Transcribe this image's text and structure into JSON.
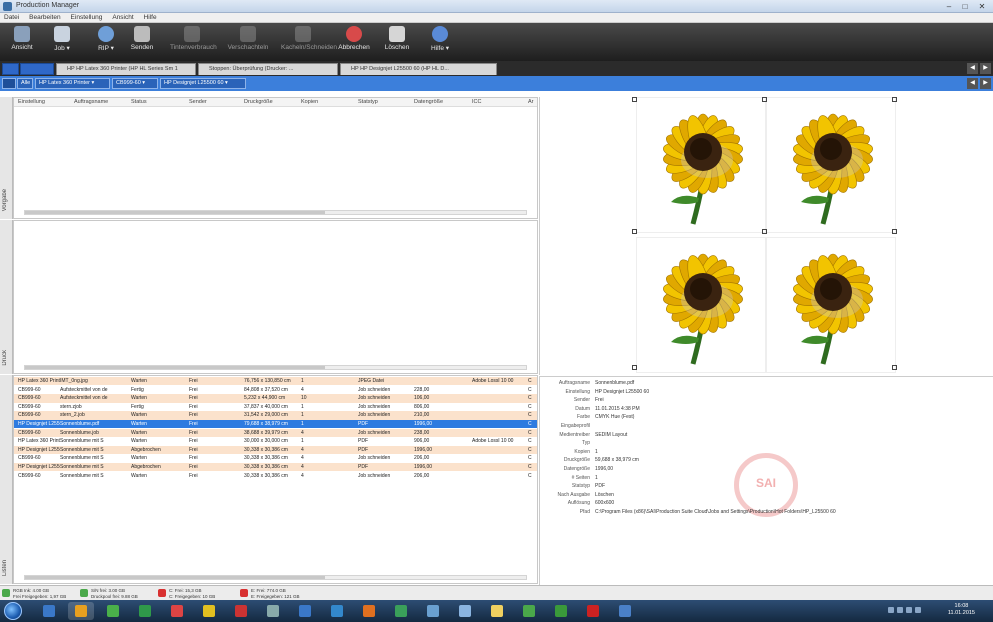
{
  "window": {
    "title": "Production Manager"
  },
  "menu": [
    "Datei",
    "Bearbeiten",
    "Einstellung",
    "Ansicht",
    "Hilfe"
  ],
  "toolbar": [
    {
      "label": "Ansicht",
      "icon": "view-icon",
      "enabled": true
    },
    {
      "label": "Job ▾",
      "icon": "folder-icon",
      "enabled": true
    },
    {
      "label": "RIP ▾",
      "icon": "rip-icon",
      "enabled": true
    },
    {
      "label": "Senden",
      "icon": "send-icon",
      "enabled": true
    },
    {
      "label": "Tintenverbrauch",
      "icon": "ink-icon",
      "enabled": false
    },
    {
      "label": "Verschachteln",
      "icon": "nest-icon",
      "enabled": false
    },
    {
      "label": "Kacheln/Schneiden",
      "icon": "tile-icon",
      "enabled": false
    },
    {
      "label": "Abbrechen",
      "icon": "cancel-icon",
      "enabled": true
    },
    {
      "label": "Löschen",
      "icon": "delete-icon",
      "enabled": true
    },
    {
      "label": "Hilfe ▾",
      "icon": "help-icon",
      "enabled": true
    }
  ],
  "tabs": [
    "HP HP Latex 360 Printer (HP HL Series Sm 1",
    "Stoppen: Überprüfung (Drucker: ...",
    "HP HP Designjet L25500 60 (HP HL D..."
  ],
  "filters": [
    "Alle",
    "HP Latex 360 Printer ▾",
    "CB999-60 ▾",
    "HP Designjet L25500 60 ▾"
  ],
  "side_labels": {
    "top": "Vorgabe",
    "mid": "Druck",
    "bottom": "Listen"
  },
  "columns": [
    "Einstellung",
    "Auftragsname",
    "Status",
    "Sender",
    "Druckgröße",
    "Kopien",
    "Statstyp",
    "Datengröße",
    "ICC",
    "Ar"
  ],
  "jobs": [
    {
      "c": [
        "HP Latex 360 Printer",
        "IMT_0ng.jpg",
        "Warten",
        "Frei",
        "76,756 x 130,850 cm",
        "1",
        "JPEG Datei",
        "",
        "Adobe Lossl 10 00",
        "C"
      ],
      "style": "peach"
    },
    {
      "c": [
        "CB999-60",
        "Aufsteckmittel von de",
        "Fertig",
        "Frei",
        "84,808 x 37,520 cm",
        "4",
        "Job schneiden",
        "228,00",
        "",
        "C"
      ],
      "style": "white"
    },
    {
      "c": [
        "CB999-60",
        "Aufsteckmittel von de",
        "Warten",
        "Frei",
        "5,232 x 44,900 cm",
        "10",
        "Job schneiden",
        "106,00",
        "",
        "C"
      ],
      "style": "peach"
    },
    {
      "c": [
        "CB999-60",
        "stern.zjob",
        "Fertig",
        "Frei",
        "37,837 x 40,000 cm",
        "1",
        "Job schneiden",
        "806,00",
        "",
        "C"
      ],
      "style": "white"
    },
    {
      "c": [
        "CB999-60",
        "stern_2.job",
        "Warten",
        "Frei",
        "31,542 x 29,000 cm",
        "1",
        "Job schneiden",
        "210,00",
        "",
        "C"
      ],
      "style": "peach"
    },
    {
      "c": [
        "HP Designjet L25500",
        "Sonnenblume.pdf",
        "Warten",
        "Frei",
        "79,688 x 38,979 cm",
        "1",
        "PDF",
        "1996,00",
        "",
        "C"
      ],
      "style": "sel"
    },
    {
      "c": [
        "CB999-60",
        "Sonnenblume.job",
        "Warten",
        "Frei",
        "38,688 x 39,979 cm",
        "4",
        "Job schneiden",
        "238,00",
        "",
        "C"
      ],
      "style": "peach"
    },
    {
      "c": [
        "HP Latex 360 Printer",
        "Sonnenblume mit S",
        "Warten",
        "Frei",
        "30,000 x 30,000 cm",
        "1",
        "PDF",
        "906,00",
        "Adobe Lossl 10 00",
        "C"
      ],
      "style": "white"
    },
    {
      "c": [
        "HP Designjet L25500",
        "Sonnenblume mit S",
        "Abgebrochen",
        "Frei",
        "30,338 x 30,386 cm",
        "4",
        "PDF",
        "1996,00",
        "",
        "C"
      ],
      "style": "peach"
    },
    {
      "c": [
        "CB999-60",
        "Sonnenblume mit S",
        "Warten",
        "Frei",
        "30,338 x 30,386 cm",
        "4",
        "Job schneiden",
        "206,00",
        "",
        "C"
      ],
      "style": "white"
    },
    {
      "c": [
        "HP Designjet L25500",
        "Sonnenblume mit S",
        "Abgebrochen",
        "Frei",
        "30,338 x 30,386 cm",
        "4",
        "PDF",
        "1996,00",
        "",
        "C"
      ],
      "style": "peach"
    },
    {
      "c": [
        "CB999-60",
        "Sonnenblume mit S",
        "Warten",
        "Frei",
        "30,338 x 30,386 cm",
        "4",
        "Job schneiden",
        "206,00",
        "",
        "C"
      ],
      "style": "white"
    }
  ],
  "details": [
    {
      "label": "Auftragsname",
      "value": "Sonnenblume.pdf"
    },
    {
      "label": "Einstellung",
      "value": "HP Designjet L25500 60"
    },
    {
      "label": "Sender",
      "value": "Frei"
    },
    {
      "label": "Datum",
      "value": "11.01.2015 4:38 PM"
    },
    {
      "label": "Farbe",
      "value": "CMYK Hue (Fest)"
    },
    {
      "label": "Eingabeprofil",
      "value": ""
    },
    {
      "label": "Medientreiber",
      "value": "SEDIM Layout"
    },
    {
      "label": "Typ",
      "value": ""
    },
    {
      "label": "Kopien",
      "value": "1"
    },
    {
      "label": "Druckgröße",
      "value": "59,688 x 38,979 cm"
    },
    {
      "label": "Datengröße",
      "value": "1996,00"
    },
    {
      "label": "# Seiten",
      "value": "1"
    },
    {
      "label": "Statstyp",
      "value": "PDF"
    },
    {
      "label": "Nach Ausgabe",
      "value": "Löschen"
    },
    {
      "label": "Auflösung",
      "value": "600x600"
    },
    {
      "label": "Pfad",
      "value": "C:\\Program Files (x86)\\SAI\\Production Suite Cloud\\Jobs and Settings\\Production\\Hot Folders\\HP_L25500 60"
    }
  ],
  "watermark": "SAI",
  "status": [
    {
      "line1": "RGB Ink: 4.00 GB",
      "line2": "Frei Freigegeben: 1,97 GB",
      "color": "#4aa84a"
    },
    {
      "line1": "S/N frei: 3.00 GB",
      "line2": "Druckpool frei: 9.88 GB",
      "color": "#4aa84a"
    },
    {
      "line1": "C: Frei: 15,3 GB",
      "line2": "C: Freigegeben: 10 GB",
      "color": "#d83030"
    },
    {
      "line1": "E: Frei: 774.0 GB",
      "line2": "E: Freigegeben: 121 GB",
      "color": "#d83030"
    }
  ],
  "clock": {
    "time": "16:08",
    "date": "11.01.2015"
  }
}
